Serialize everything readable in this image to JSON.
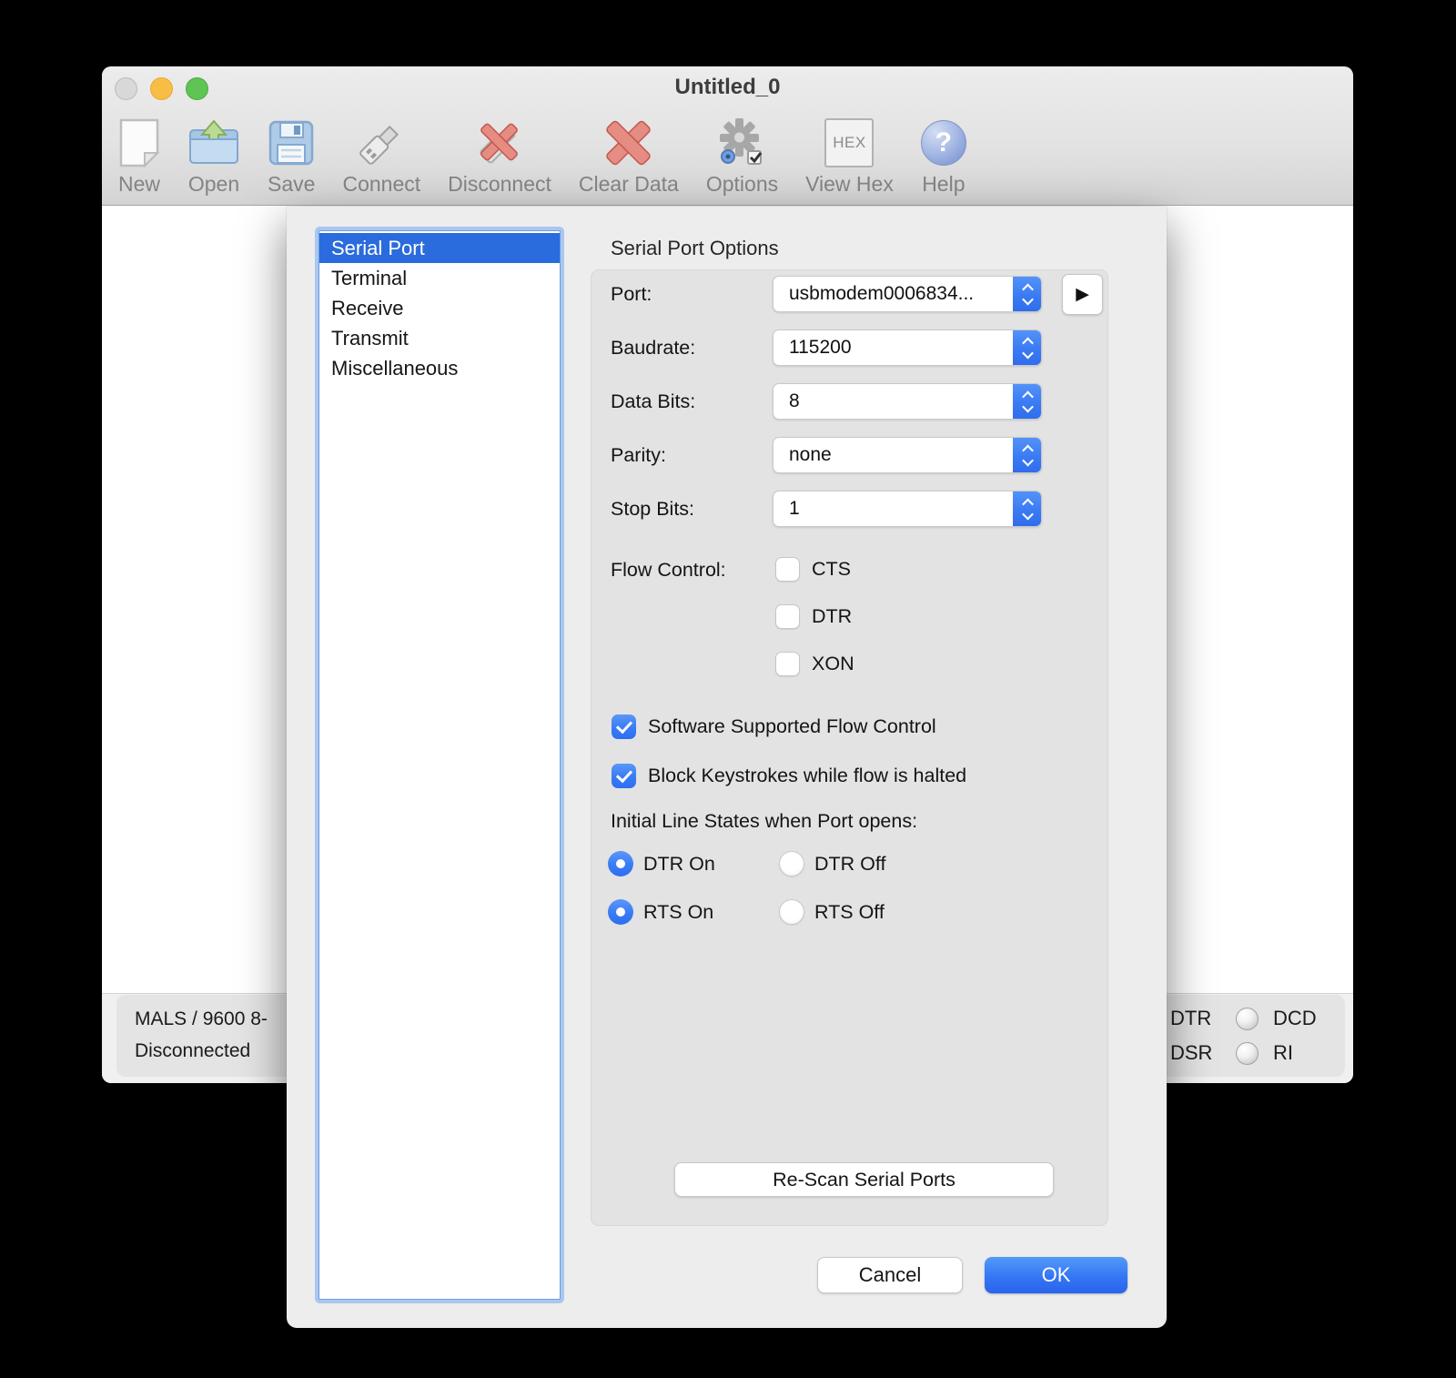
{
  "window": {
    "title": "Untitled_0"
  },
  "toolbar": {
    "items": [
      {
        "label": "New"
      },
      {
        "label": "Open"
      },
      {
        "label": "Save"
      },
      {
        "label": "Connect"
      },
      {
        "label": "Disconnect"
      },
      {
        "label": "Clear Data"
      },
      {
        "label": "Options"
      },
      {
        "label": "View Hex"
      },
      {
        "label": "Help"
      }
    ],
    "hex_icon_text": "HEX",
    "help_icon_glyph": "?"
  },
  "dialog": {
    "categories": {
      "items": [
        {
          "label": "Serial Port",
          "selected": true
        },
        {
          "label": "Terminal",
          "selected": false
        },
        {
          "label": "Receive",
          "selected": false
        },
        {
          "label": "Transmit",
          "selected": false
        },
        {
          "label": "Miscellaneous",
          "selected": false
        }
      ]
    },
    "heading": "Serial Port Options",
    "fields": [
      {
        "label": "Port:",
        "value": "usbmodem0006834..."
      },
      {
        "label": "Baudrate:",
        "value": "115200"
      },
      {
        "label": "Data Bits:",
        "value": "8"
      },
      {
        "label": "Parity:",
        "value": "none"
      },
      {
        "label": "Stop Bits:",
        "value": "1"
      }
    ],
    "port_detail_button_glyph": "▶",
    "flow_control": {
      "label": "Flow Control:",
      "options": [
        {
          "label": "CTS",
          "checked": false
        },
        {
          "label": "DTR",
          "checked": false
        },
        {
          "label": "XON",
          "checked": false
        }
      ]
    },
    "software_flow": {
      "label": "Software Supported Flow Control",
      "checked": true
    },
    "block_keystrokes": {
      "label": "Block Keystrokes while flow is halted",
      "checked": true
    },
    "line_states": {
      "heading": "Initial Line States when Port opens:",
      "options": [
        {
          "label": "DTR On",
          "selected": true
        },
        {
          "label": "DTR Off",
          "selected": false
        },
        {
          "label": "RTS On",
          "selected": true
        },
        {
          "label": "RTS Off",
          "selected": false
        }
      ]
    },
    "rescan_label": "Re-Scan Serial Ports",
    "cancel_label": "Cancel",
    "ok_label": "OK"
  },
  "statusbar": {
    "left_line1": "MALS / 9600 8-",
    "left_line2": "Disconnected",
    "indicators": [
      {
        "label": "DTR"
      },
      {
        "label": "DCD"
      },
      {
        "label": "DSR"
      },
      {
        "label": "RI"
      }
    ]
  },
  "colors": {
    "selection_blue": "#2a6bdd",
    "accent_blue": "#3a7bf4",
    "ok_gradient_top": "#549af9",
    "ok_gradient_bottom": "#2a64ee"
  }
}
